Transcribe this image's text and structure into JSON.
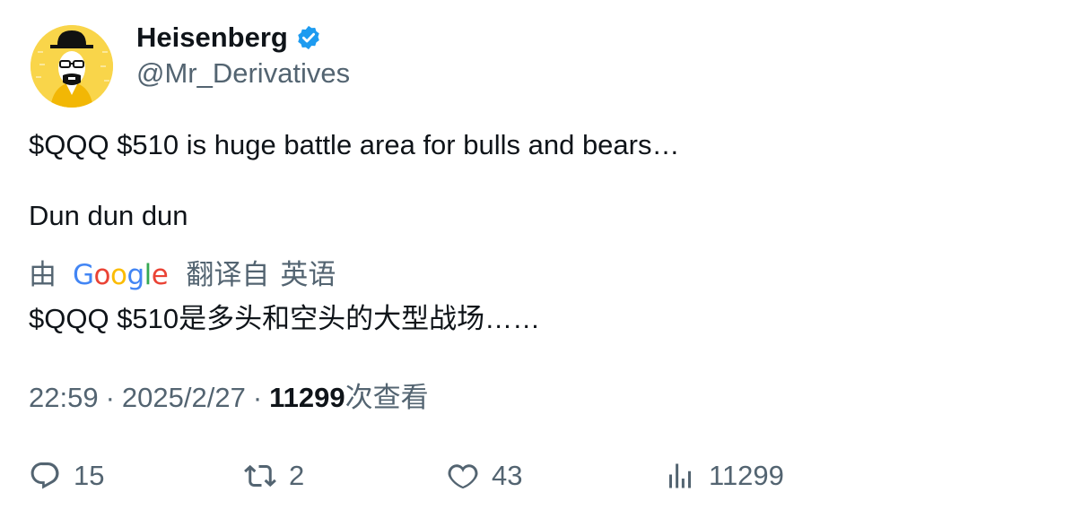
{
  "author": {
    "display_name": "Heisenberg",
    "handle": "@Mr_Derivatives",
    "verified": true,
    "verified_color": "#1d9bf0"
  },
  "tweet": {
    "text_line1": "$QQQ $510 is huge battle area for bulls and bears…",
    "text_line2": "Dun dun dun",
    "translation": {
      "by_label": "由",
      "provider": "Google",
      "translated_from_label": "翻译自",
      "source_language": "英语",
      "translated_text": "$QQQ $510是多头和空头的大型战场……"
    }
  },
  "meta": {
    "time": "22:59",
    "separator": "·",
    "date": "2025/2/27",
    "views_count": "11299",
    "views_label": "次查看"
  },
  "actions": {
    "replies": "15",
    "retweets": "2",
    "likes": "43",
    "views": "11299"
  },
  "colors": {
    "text_primary": "#0f1419",
    "text_secondary": "#536471",
    "avatar_background": "#f5c518"
  }
}
